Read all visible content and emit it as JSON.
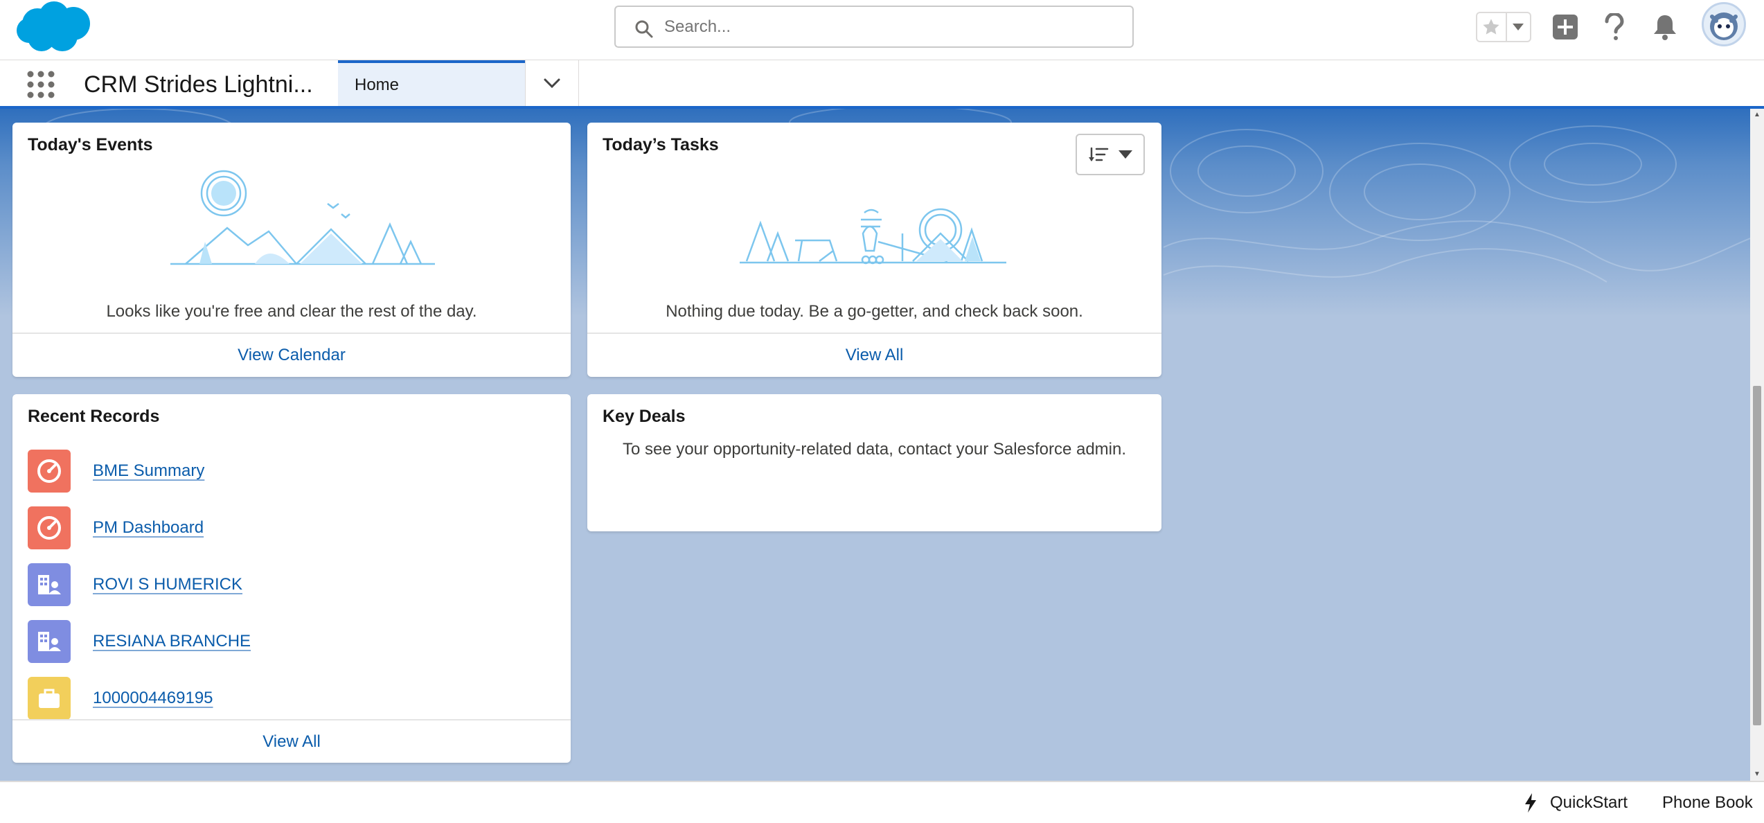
{
  "header": {
    "search_placeholder": "Search...",
    "icons": [
      "salesforce-cloud-logo",
      "search-icon",
      "star-icon",
      "caret-down-icon",
      "plus-icon",
      "help-icon",
      "bell-icon",
      "avatar-astro"
    ]
  },
  "nav": {
    "app_name": "CRM Strides Lightni...",
    "tabs": [
      {
        "label": "Home",
        "active": true
      }
    ]
  },
  "cards": {
    "events": {
      "title": "Today's Events",
      "message": "Looks like you're free and clear the rest of the day.",
      "footer": "View Calendar"
    },
    "tasks": {
      "title": "Today’s Tasks",
      "message": "Nothing due today. Be a go-getter, and check back soon.",
      "footer": "View All"
    },
    "recent": {
      "title": "Recent Records",
      "items": [
        {
          "label": "BME Summary",
          "icon": "dashboard-icon",
          "color": "#f0725f"
        },
        {
          "label": "PM Dashboard",
          "icon": "dashboard-icon",
          "color": "#f0725f"
        },
        {
          "label": "ROVI S HUMERICK",
          "icon": "account-icon",
          "color": "#7f8de1"
        },
        {
          "label": "RESIANA BRANCHE",
          "icon": "account-icon",
          "color": "#7f8de1"
        },
        {
          "label": "1000004469195",
          "icon": "briefcase-icon",
          "color": "#f2cf5b"
        }
      ],
      "footer": "View All"
    },
    "deals": {
      "title": "Key Deals",
      "message": "To see your opportunity-related data, contact your Salesforce admin."
    }
  },
  "utility_bar": {
    "quickstart": "QuickStart",
    "phonebook": "Phone Book"
  },
  "colors": {
    "brand_blue": "#1b66c9",
    "link": "#0b5cab",
    "background": "#b0c4df"
  }
}
